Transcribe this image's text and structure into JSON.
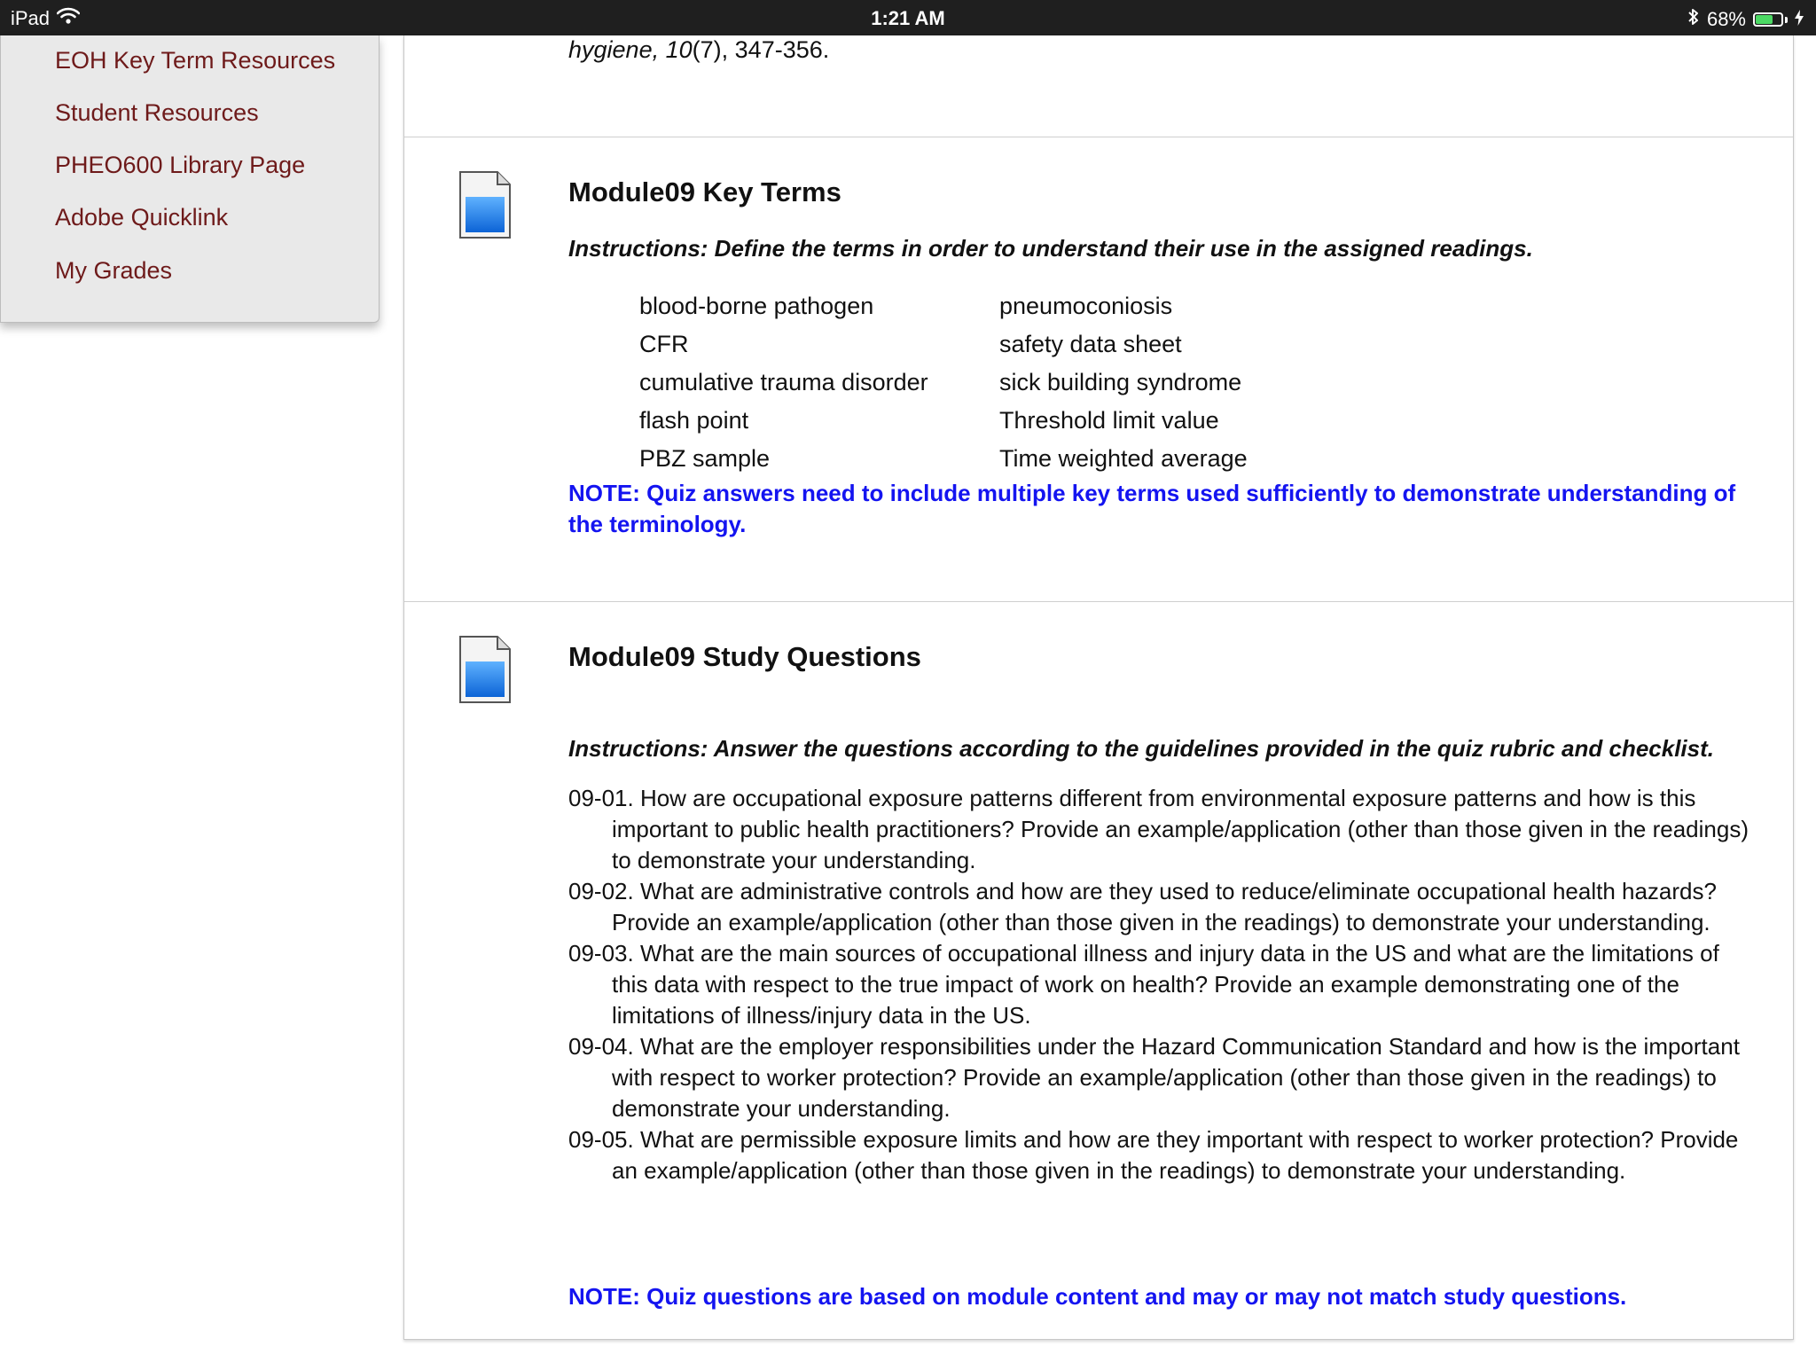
{
  "status_bar": {
    "device": "iPad",
    "time": "1:21 AM",
    "battery": "68%",
    "battery_level": 0.68
  },
  "menu": {
    "items": [
      {
        "label": "EOH Key Term Resources"
      },
      {
        "label": "Student Resources"
      },
      {
        "label": "PHEO600 Library Page"
      },
      {
        "label": "Adobe Quicklink"
      },
      {
        "label": "My Grades"
      }
    ]
  },
  "content": {
    "citation": {
      "journal": "hygiene,",
      "volume": "10",
      "rest": "(7), 347-356."
    },
    "key_terms": {
      "title": "Module09 Key Terms",
      "instructions": "Instructions: Define the terms in order to understand their use in the assigned readings.",
      "terms_left": [
        "blood-borne pathogen",
        "CFR",
        "cumulative trauma disorder",
        "flash point",
        "PBZ sample"
      ],
      "terms_right": [
        "pneumoconiosis",
        "safety data sheet",
        "sick building syndrome",
        "Threshold limit value",
        "Time weighted average"
      ],
      "note": "NOTE: Quiz answers need to include multiple key terms used sufficiently to demonstrate understanding of the terminology."
    },
    "study_questions": {
      "title": "Module09 Study Questions",
      "instructions": "Instructions: Answer the questions according to the guidelines provided in the quiz rubric and checklist.",
      "questions": [
        "09-01. How are occupational exposure patterns different from environmental exposure patterns and how is this important to public health practitioners? Provide an example/application (other than those given in the readings) to demonstrate your understanding.",
        "09-02. What are administrative controls and how are they used to reduce/eliminate occupational health hazards? Provide an example/application (other than those given in the readings) to demonstrate your understanding.",
        "09-03. What are the main sources of occupational illness and injury data in the US and what are the limitations of this data with respect to the true impact of work on health? Provide an example demonstrating one of the limitations of illness/injury data in the US.",
        "09-04. What are the employer responsibilities under the Hazard Communication Standard and how is the important with respect to worker protection? Provide an example/application (other than those given in the readings) to demonstrate your understanding.",
        "09-05. What are permissible exposure limits and how are they important with respect to worker protection? Provide an example/application (other than those given in the readings) to demonstrate your understanding."
      ],
      "note": "NOTE: Quiz questions are based on module content and may or may not match study questions."
    }
  },
  "icons": {
    "wifi": "wifi-icon",
    "bluetooth": "bluetooth-icon",
    "battery": "battery-icon",
    "charging": "charging-bolt-icon",
    "document": "document-icon"
  },
  "colors": {
    "status_bar_bg": "#1f1f1f",
    "menu_link": "#6e1a1a",
    "note_blue": "#1414f0",
    "battery_green": "#4cd964",
    "icon_blue": "#1e78e6"
  }
}
